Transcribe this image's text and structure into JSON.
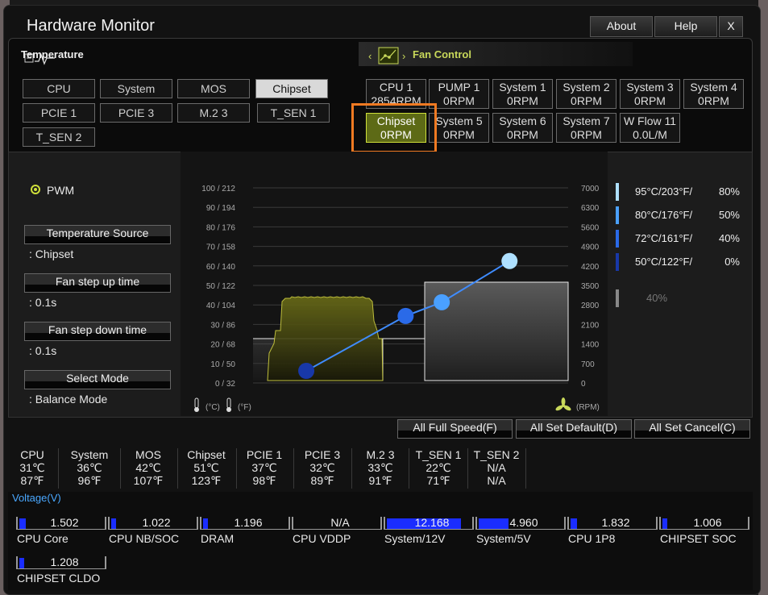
{
  "window": {
    "title": "Hardware Monitor",
    "about": "About",
    "help": "Help",
    "close": "X"
  },
  "temperature": {
    "header": "Temperature",
    "sources": [
      "CPU",
      "System",
      "MOS",
      "Chipset",
      "PCIE 1",
      "PCIE 3",
      "M.2 3",
      "T_SEN 1",
      "T_SEN 2"
    ],
    "selected": "Chipset"
  },
  "fan_control": {
    "header": "Fan Control",
    "fans": [
      {
        "name": "CPU 1",
        "value": "2854RPM"
      },
      {
        "name": "PUMP 1",
        "value": "0RPM"
      },
      {
        "name": "System 1",
        "value": "0RPM"
      },
      {
        "name": "System 2",
        "value": "0RPM"
      },
      {
        "name": "System 3",
        "value": "0RPM"
      },
      {
        "name": "System 4",
        "value": "0RPM"
      },
      {
        "name": "Chipset",
        "value": "0RPM"
      },
      {
        "name": "System 5",
        "value": "0RPM"
      },
      {
        "name": "System 6",
        "value": "0RPM"
      },
      {
        "name": "System 7",
        "value": "0RPM"
      },
      {
        "name": "W Flow 11",
        "value": "0.0L/M"
      }
    ],
    "selected": "Chipset"
  },
  "settings": {
    "mode": "PWM",
    "temp_source_label": "Temperature Source",
    "temp_source_value": ": Chipset",
    "step_up_label": "Fan step up time",
    "step_up_value": ": 0.1s",
    "step_down_label": "Fan step down time",
    "step_down_value": ": 0.1s",
    "select_mode_label": "Select Mode",
    "select_mode_value": ": Balance Mode"
  },
  "chart_data": {
    "type": "line",
    "left_ticks": [
      "100 / 212",
      "90 / 194",
      "80 / 176",
      "70 / 158",
      "60 / 140",
      "50 / 122",
      "40 / 104",
      "30 /  86",
      "20 /  68",
      "10 /  50",
      "0 /  32"
    ],
    "right_ticks": [
      "7000",
      "6300",
      "5600",
      "4900",
      "4200",
      "3500",
      "2800",
      "2100",
      "1400",
      "700",
      "0"
    ],
    "left_unit_c": "(°C)",
    "left_unit_f": "(°F)",
    "right_unit": "(RPM)",
    "curve_points": [
      {
        "temp": 50,
        "pct": 0
      },
      {
        "temp": 72,
        "pct": 40
      },
      {
        "temp": 80,
        "pct": 50
      },
      {
        "temp": 95,
        "pct": 80
      }
    ],
    "ylim_temp": [
      0,
      100
    ]
  },
  "legend": [
    {
      "temp": "95°C/203°F/",
      "pct": "80%",
      "color": "#aee0ff"
    },
    {
      "temp": "80°C/176°F/",
      "pct": "50%",
      "color": "#4aa0ff"
    },
    {
      "temp": "72°C/161°F/",
      "pct": "40%",
      "color": "#2a6ae8"
    },
    {
      "temp": "50°C/122°F/",
      "pct": "0%",
      "color": "#1838a8"
    }
  ],
  "legend_current": "40%",
  "bottom_buttons": {
    "full": "All Full Speed(F)",
    "default": "All Set Default(D)",
    "cancel": "All Set Cancel(C)"
  },
  "monitors": [
    {
      "name": "CPU",
      "c": "31℃",
      "f": "87℉"
    },
    {
      "name": "System",
      "c": "36℃",
      "f": "96℉"
    },
    {
      "name": "MOS",
      "c": "42℃",
      "f": "107℉"
    },
    {
      "name": "Chipset",
      "c": "51℃",
      "f": "123℉"
    },
    {
      "name": "PCIE 1",
      "c": "37℃",
      "f": "98℉"
    },
    {
      "name": "PCIE 3",
      "c": "32℃",
      "f": "89℉"
    },
    {
      "name": "M.2 3",
      "c": "33℃",
      "f": "91℉"
    },
    {
      "name": "T_SEN 1",
      "c": "22℃",
      "f": "71℉"
    },
    {
      "name": "T_SEN 2",
      "c": "N/A",
      "f": "N/A"
    }
  ],
  "voltage": {
    "title": "Voltage(V)",
    "items": [
      {
        "name": "CPU Core",
        "value": "1.502",
        "fill": 0.08
      },
      {
        "name": "CPU NB/SOC",
        "value": "1.022",
        "fill": 0.06
      },
      {
        "name": "DRAM",
        "value": "1.196",
        "fill": 0.06
      },
      {
        "name": "CPU VDDP",
        "value": "N/A",
        "fill": 0
      },
      {
        "name": "System/12V",
        "value": "12.168",
        "fill": 0.88
      },
      {
        "name": "System/5V",
        "value": "4.960",
        "fill": 0.36
      },
      {
        "name": "CPU 1P8",
        "value": "1.832",
        "fill": 0.08
      },
      {
        "name": "CHIPSET SOC",
        "value": "1.006",
        "fill": 0.06
      },
      {
        "name": "CHIPSET CLDO",
        "value": "1.208",
        "fill": 0.06
      }
    ]
  }
}
